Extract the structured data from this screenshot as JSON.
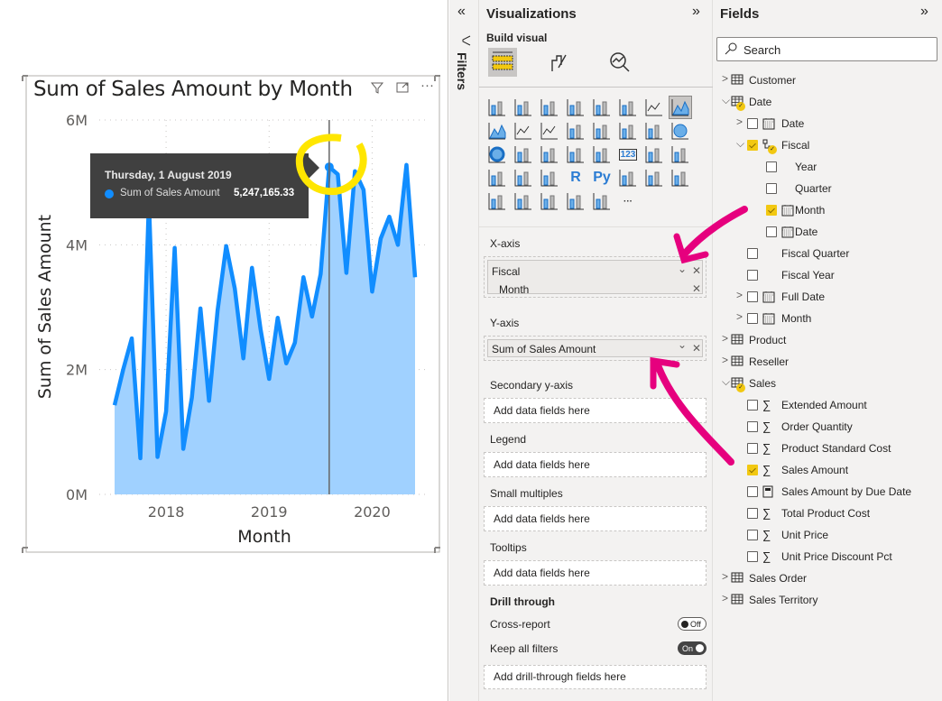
{
  "visual": {
    "title": "Sum of Sales Amount by Month",
    "icons": {
      "filter": "filter-icon",
      "focus": "focus-mode-icon",
      "more": "more-options-icon"
    },
    "tooltip": {
      "date": "Thursday, 1 August 2019",
      "series": "Sum of Sales Amount",
      "value": "5,247,165.33"
    }
  },
  "chart_data": {
    "type": "area",
    "title": "Sum of Sales Amount by Month",
    "xlabel": "Month",
    "ylabel": "Sum of Sales Amount",
    "x_start": "2017-07",
    "x_end": "2020-06",
    "x_ticks": [
      {
        "label": "2018",
        "index": 6
      },
      {
        "label": "2019",
        "index": 18
      },
      {
        "label": "2020",
        "index": 30
      }
    ],
    "y_ticks": [
      {
        "label": "0M",
        "value": 0
      },
      {
        "label": "2M",
        "value": 2
      },
      {
        "label": "4M",
        "value": 4
      },
      {
        "label": "6M",
        "value": 6
      }
    ],
    "ylim": [
      0,
      6
    ],
    "y_unit": "millions",
    "series": [
      {
        "name": "Sum of Sales Amount",
        "color": "#118dff",
        "fill": "#a0d1ff",
        "values": [
          1.43,
          2.0,
          2.5,
          0.58,
          4.7,
          0.6,
          1.33,
          3.95,
          0.73,
          1.55,
          2.98,
          1.5,
          2.95,
          3.98,
          3.3,
          2.18,
          3.63,
          2.65,
          1.85,
          2.83,
          2.1,
          2.43,
          3.48,
          2.85,
          3.53,
          5.247,
          5.13,
          3.55,
          5.18,
          4.88,
          3.25,
          4.1,
          4.45,
          4.0,
          5.28,
          3.48
        ]
      }
    ],
    "highlight_index": 25,
    "grid": true
  },
  "filters": {
    "label": "Filters"
  },
  "viz": {
    "title": "Visualizations",
    "build_visual": "Build visual",
    "tabs": [
      "build-visual",
      "format-visual",
      "analytics"
    ],
    "icons": [
      "stacked-bar",
      "stacked-column",
      "clustered-bar",
      "clustered-column",
      "100-stacked-bar",
      "100-stacked-column",
      "line",
      "area",
      "stacked-area",
      "line-stacked-column",
      "line-clustered-column",
      "ribbon",
      "waterfall",
      "funnel",
      "scatter",
      "pie",
      "donut",
      "treemap",
      "map",
      "filled-map",
      "gauge",
      "card",
      "multi-row-card",
      "kpi",
      "slicer",
      "table",
      "matrix",
      "r-visual",
      "python-visual",
      "key-influencers",
      "decomposition-tree",
      "qa",
      "paginated-report",
      "smart-narrative",
      "arcgis-map",
      "power-apps",
      "power-automate",
      "more"
    ],
    "selected_icon": "area",
    "icon_text": {
      "card": "123",
      "r-visual": "R",
      "python-visual": "Py",
      "more": "···"
    },
    "x_axis": {
      "label": "X-axis",
      "field": "Fiscal",
      "subfield": "Month"
    },
    "y_axis": {
      "label": "Y-axis",
      "field": "Sum of Sales Amount"
    },
    "wells": [
      {
        "label": "Secondary y-axis",
        "placeholder": "Add data fields here"
      },
      {
        "label": "Legend",
        "placeholder": "Add data fields here"
      },
      {
        "label": "Small multiples",
        "placeholder": "Add data fields here"
      },
      {
        "label": "Tooltips",
        "placeholder": "Add data fields here"
      }
    ],
    "drill": {
      "title": "Drill through",
      "cross_report": "Cross-report",
      "cross_state": "Off",
      "keep_filters": "Keep all filters",
      "keep_state": "On",
      "placeholder": "Add drill-through fields here"
    }
  },
  "fields": {
    "title": "Fields",
    "search_placeholder": "Search",
    "items": [
      {
        "label": "Customer",
        "level": 0,
        "chev": "right",
        "icon": "table"
      },
      {
        "label": "Date",
        "level": 0,
        "chev": "down",
        "icon": "table",
        "badge": true
      },
      {
        "label": "Date",
        "level": 1,
        "chev": "right",
        "cb": false,
        "icon": "calendar"
      },
      {
        "label": "Fiscal",
        "level": 1,
        "chev": "down",
        "cb": true,
        "icon": "hierarchy",
        "badge": true
      },
      {
        "label": "Year",
        "level": 2,
        "cb": false,
        "icon": "none"
      },
      {
        "label": "Quarter",
        "level": 2,
        "cb": false,
        "icon": "none"
      },
      {
        "label": "Month",
        "level": 2,
        "cb": true,
        "icon": "calendar"
      },
      {
        "label": "Date",
        "level": 2,
        "cb": false,
        "icon": "calendar"
      },
      {
        "label": "Fiscal Quarter",
        "level": 1,
        "cb": false,
        "icon": "none"
      },
      {
        "label": "Fiscal Year",
        "level": 1,
        "cb": false,
        "icon": "none"
      },
      {
        "label": "Full Date",
        "level": 1,
        "chev": "right",
        "cb": false,
        "icon": "calendar"
      },
      {
        "label": "Month",
        "level": 1,
        "chev": "right",
        "cb": false,
        "icon": "calendar"
      },
      {
        "label": "Product",
        "level": 0,
        "chev": "right",
        "icon": "table"
      },
      {
        "label": "Reseller",
        "level": 0,
        "chev": "right",
        "icon": "table"
      },
      {
        "label": "Sales",
        "level": 0,
        "chev": "down",
        "icon": "table",
        "badge": true
      },
      {
        "label": "Extended Amount",
        "level": 1,
        "cb": false,
        "icon": "sigma"
      },
      {
        "label": "Order Quantity",
        "level": 1,
        "cb": false,
        "icon": "sigma"
      },
      {
        "label": "Product Standard Cost",
        "level": 1,
        "cb": false,
        "icon": "sigma"
      },
      {
        "label": "Sales Amount",
        "level": 1,
        "cb": true,
        "icon": "sigma"
      },
      {
        "label": "Sales Amount by Due Date",
        "level": 1,
        "cb": false,
        "icon": "calculator"
      },
      {
        "label": "Total Product Cost",
        "level": 1,
        "cb": false,
        "icon": "sigma"
      },
      {
        "label": "Unit Price",
        "level": 1,
        "cb": false,
        "icon": "sigma"
      },
      {
        "label": "Unit Price Discount Pct",
        "level": 1,
        "cb": false,
        "icon": "sigma"
      },
      {
        "label": "Sales Order",
        "level": 0,
        "chev": "right",
        "icon": "table"
      },
      {
        "label": "Sales Territory",
        "level": 0,
        "chev": "right",
        "icon": "table"
      }
    ]
  }
}
